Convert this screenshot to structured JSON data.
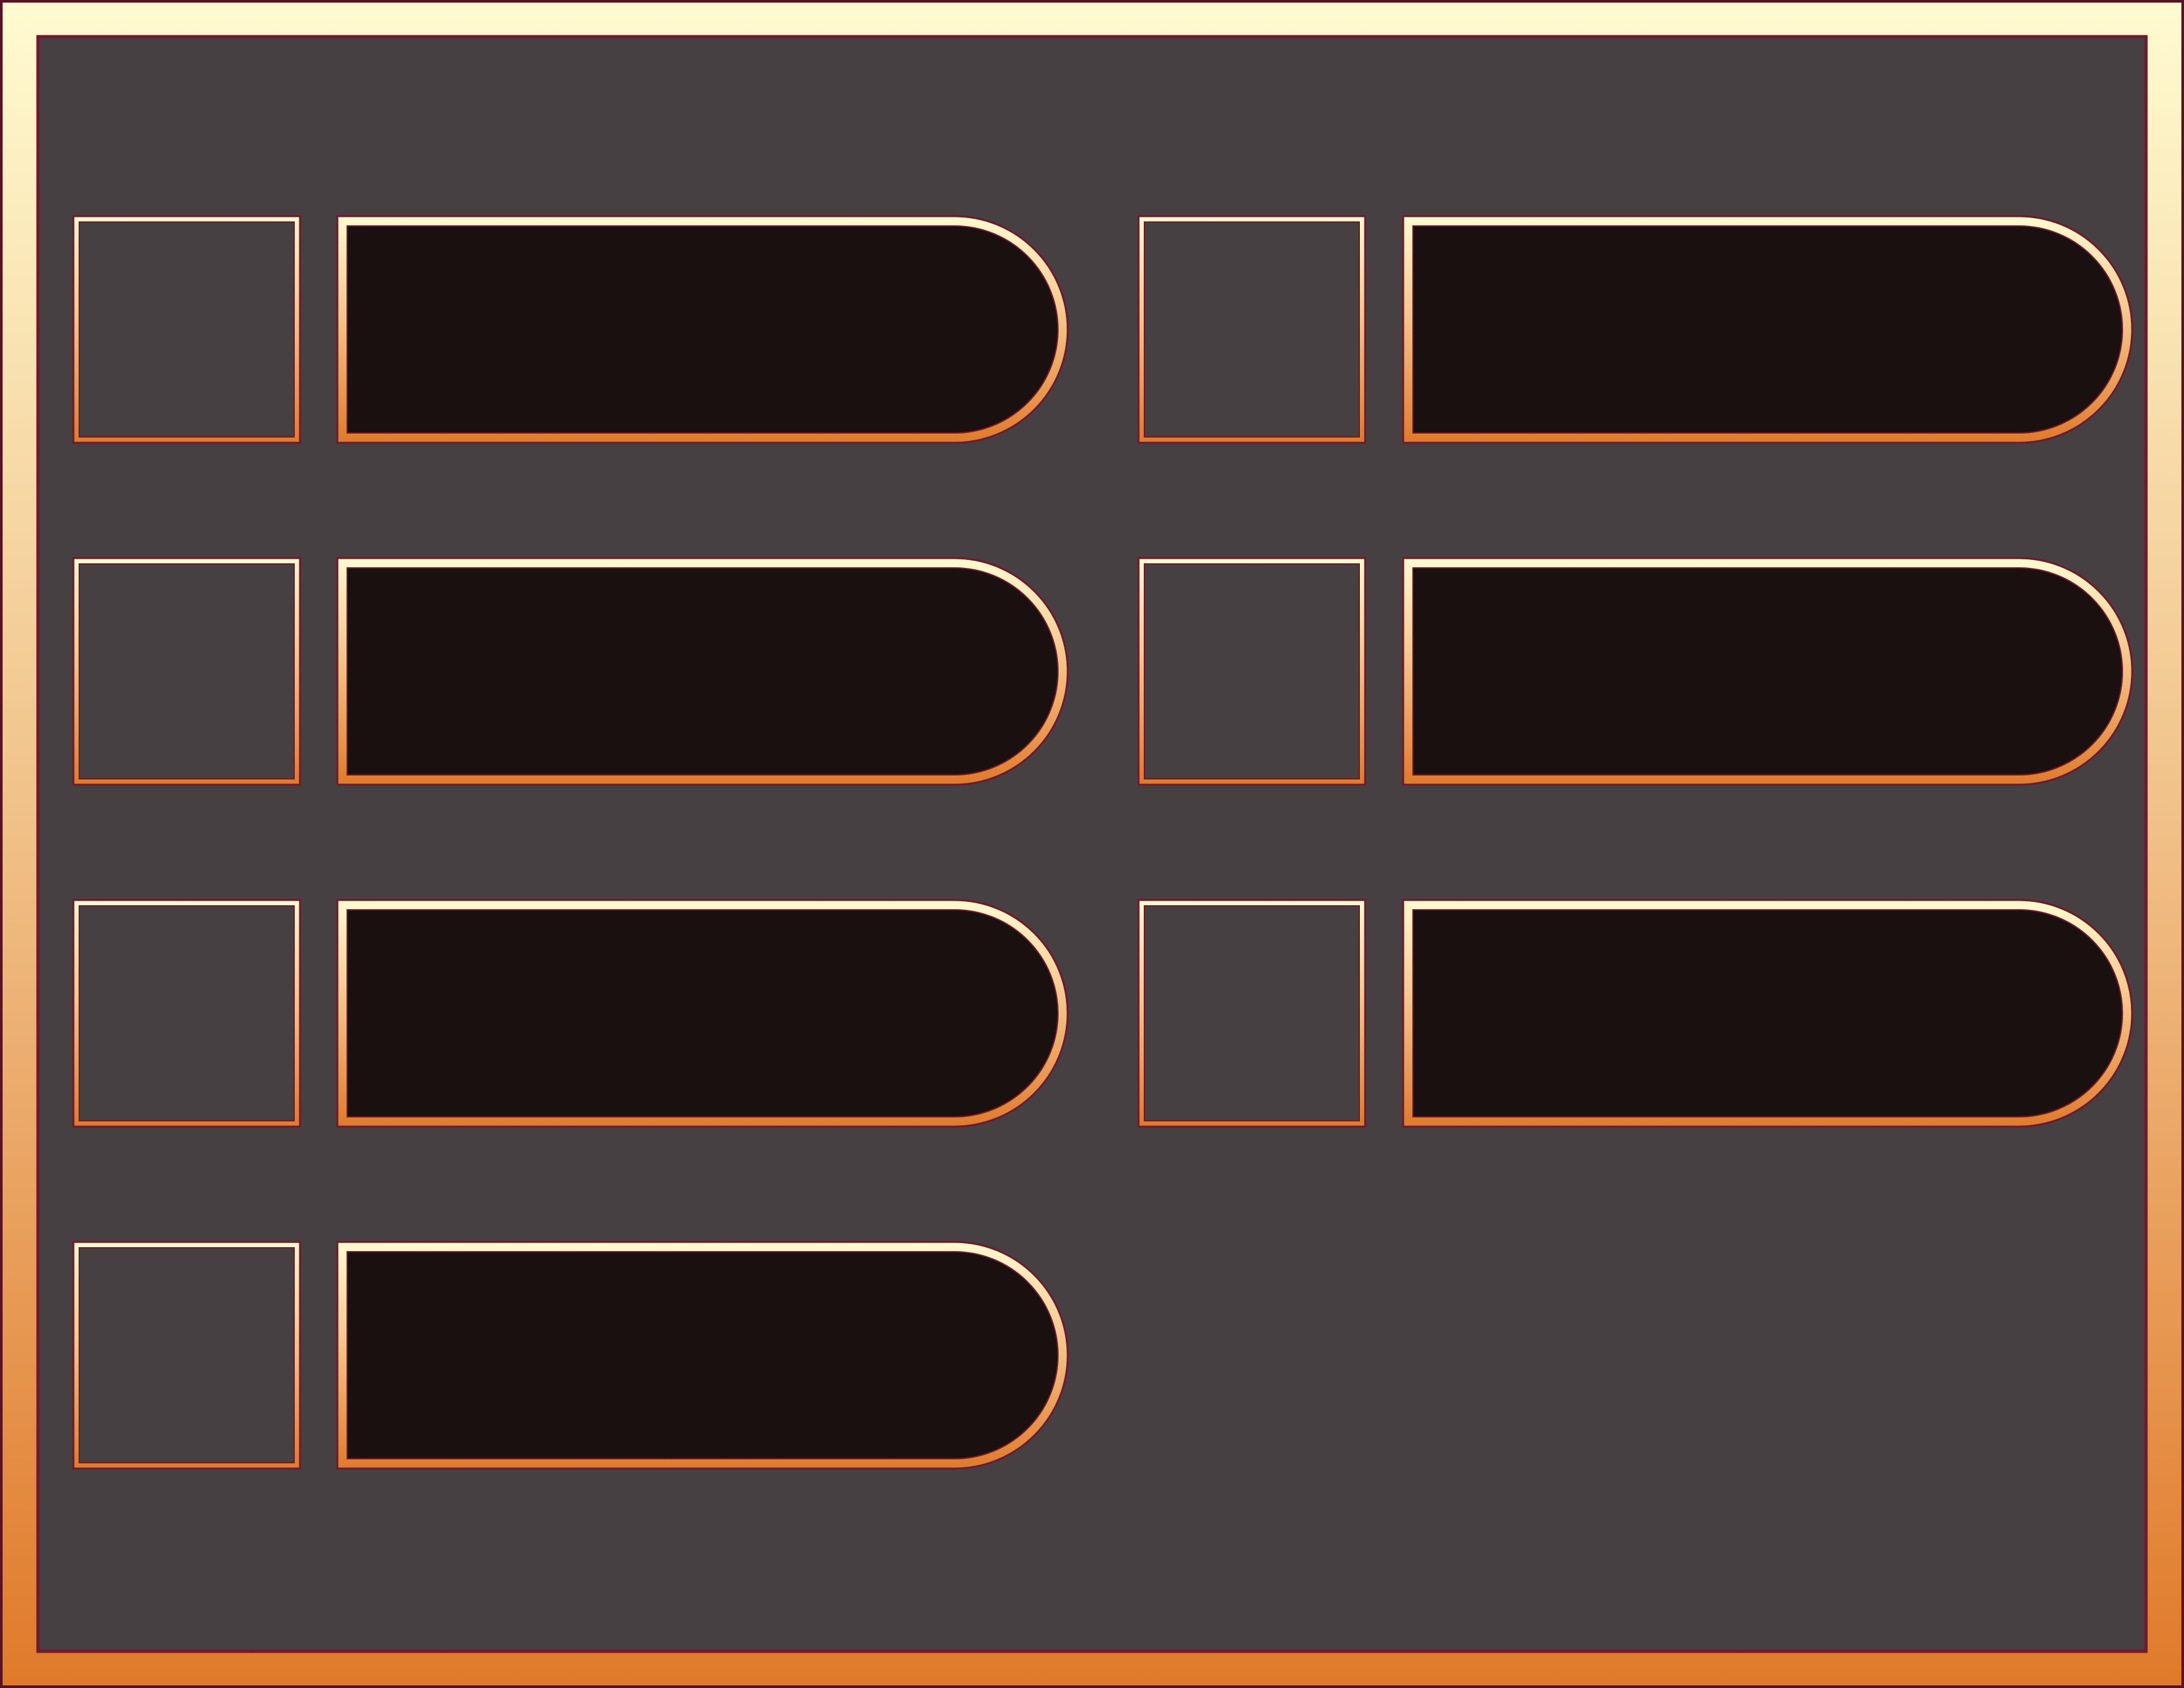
{
  "panel": {
    "frame_colors": {
      "top": "#fffbd0",
      "middle": "#f2b878",
      "bottom": "#e07a2a"
    },
    "edge_color": "#6e1a30",
    "background_color": "#474042",
    "slot_fill_color": "#1a100f",
    "icon_slot_fill_color": "#474042"
  },
  "left_column": {
    "slots": [
      {
        "icon": "empty-item-icon-slot",
        "label": ""
      },
      {
        "icon": "empty-item-icon-slot",
        "label": ""
      },
      {
        "icon": "empty-item-icon-slot",
        "label": ""
      },
      {
        "icon": "empty-item-icon-slot",
        "label": ""
      }
    ]
  },
  "right_column": {
    "slots": [
      {
        "icon": "empty-item-icon-slot",
        "label": ""
      },
      {
        "icon": "empty-item-icon-slot",
        "label": ""
      },
      {
        "icon": "empty-item-icon-slot",
        "label": ""
      }
    ]
  }
}
